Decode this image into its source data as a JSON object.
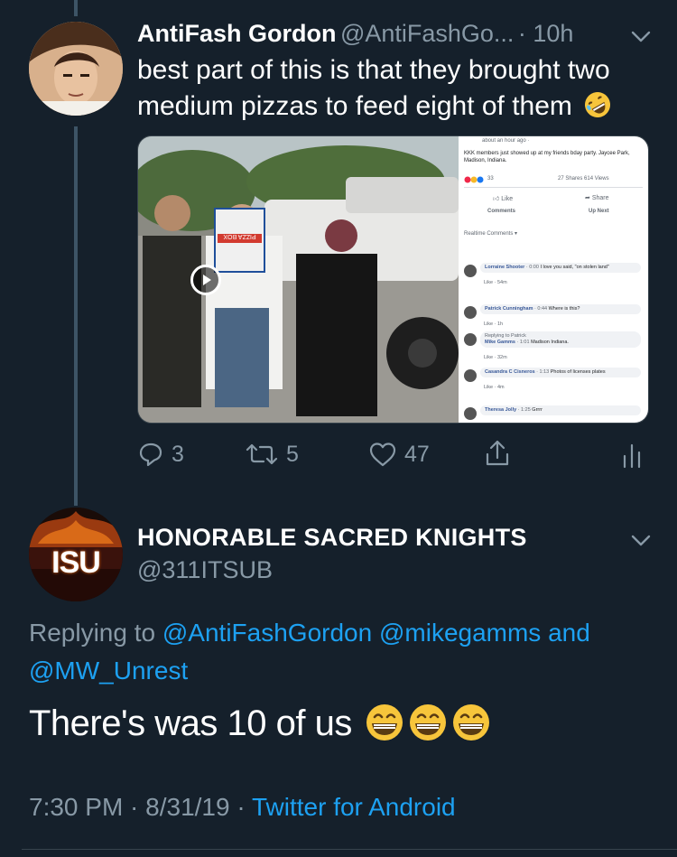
{
  "tweet1": {
    "display_name": "AntiFash Gordon",
    "handle": "@AntiFashGo...",
    "time": "· 10h",
    "text": "best part of this is that they brought two medium pizzas to feed eight of them",
    "emoji": "rolling-on-floor-laughing",
    "actions": {
      "replies": "3",
      "retweets": "5",
      "likes": "47"
    }
  },
  "embedded_media": {
    "pizza_box_text": "PIZZA BOX",
    "fb_post": {
      "time": "about an hour ago · ",
      "text": "KKK members just showed up at my friends bday party. Jaycee Park, Madison, Indiana.",
      "reactions": "33",
      "shares_views": "27 Shares  614 Views",
      "like": "Like",
      "share": "Share",
      "comments_tab": "Comments",
      "upnext_tab": "Up Next",
      "realtime": "Realtime Comments ▾",
      "comments": [
        {
          "name": "Lorraine Shooter",
          "time": "0:00",
          "text": "I love you said, \"on stolen land\"",
          "meta": "Like · 54m"
        },
        {
          "name": "Patrick Cunningham",
          "time": "0:44",
          "text": "Where is this?",
          "meta": "Like · 1h"
        },
        {
          "name": "Mike Gamms",
          "replying": "Replying to Patrick",
          "time": "1:01",
          "text": "Madison Indiana.",
          "meta": "Like · 32m"
        },
        {
          "name": "Casandra C Cisneros",
          "time": "1:13",
          "text": "Photos of licenses plates",
          "meta": "Like · 4m"
        },
        {
          "name": "Theresa Jolly",
          "time": "1:25",
          "text": "Grrrr",
          "meta": ""
        }
      ]
    }
  },
  "tweet2": {
    "display_name": "HONORABLE SACRED KNIGHTS",
    "handle": "@311ITSUB",
    "avatar_text": "ISU",
    "replying_prefix": "Replying to ",
    "reply_to_1": "@AntiFashGordon",
    "reply_to_2": "@mikegamms",
    "reply_and": " and",
    "reply_to_3": "@MW_Unrest",
    "text": "There's was 10 of us",
    "emojis": [
      "grinning-face",
      "grinning-face",
      "grinning-face"
    ],
    "timestamp": "7:30 PM · 8/31/19 · ",
    "source": "Twitter for Android"
  },
  "colors": {
    "bg": "#15202b",
    "link": "#1da1f2",
    "secondary": "#8899a6"
  }
}
